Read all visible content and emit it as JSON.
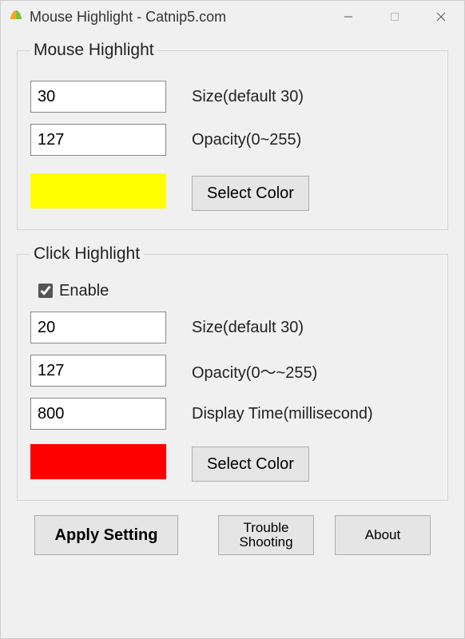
{
  "window": {
    "title": "Mouse Highlight - Catnip5.com"
  },
  "mouse_highlight": {
    "legend": "Mouse Highlight",
    "size_value": "30",
    "size_label": "Size(default 30)",
    "opacity_value": "127",
    "opacity_label": "Opacity(0~255)",
    "color": "#ffff00",
    "select_color_label": "Select Color"
  },
  "click_highlight": {
    "legend": "Click Highlight",
    "enable_label": "Enable",
    "enable_checked": true,
    "size_value": "20",
    "size_label": "Size(default 30)",
    "opacity_value": "127",
    "opacity_label": "Opacity(0～~255)",
    "display_time_value": "800",
    "display_time_label": "Display Time(millisecond)",
    "color": "#ff0000",
    "select_color_label": "Select Color"
  },
  "buttons": {
    "apply": "Apply Setting",
    "trouble_line1": "Trouble",
    "trouble_line2": "Shooting",
    "about": "About"
  }
}
